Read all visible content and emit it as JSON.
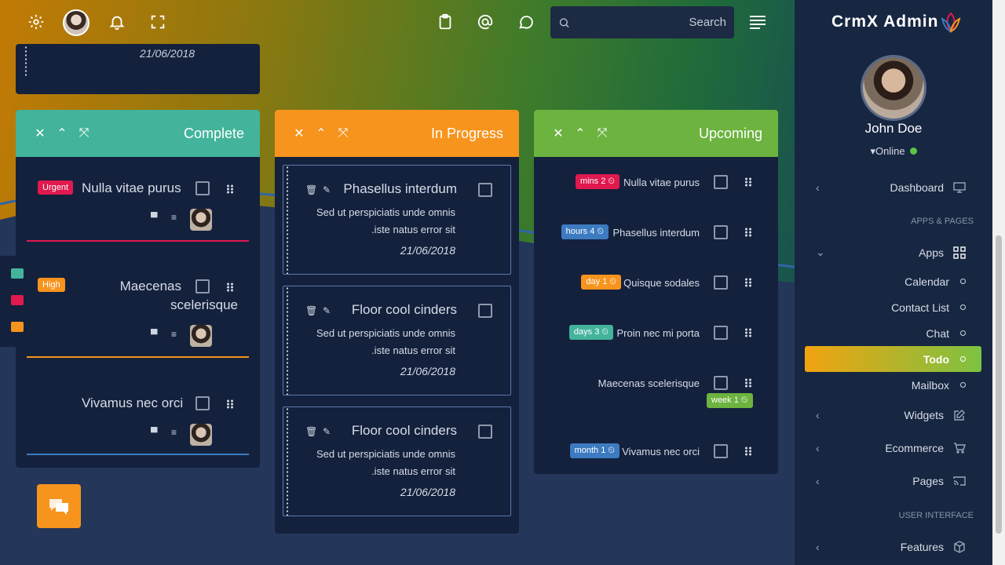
{
  "brand": {
    "name": "CrmX Admin"
  },
  "search": {
    "placeholder": "Search"
  },
  "top_card": {
    "date": "21/06/2018"
  },
  "columns": {
    "complete": {
      "title": "Complete",
      "items": [
        {
          "badge": "Urgent",
          "name": "Nulla vitae purus"
        },
        {
          "badge": "High",
          "name_line1": "Maecenas",
          "name_line2": "scelerisque"
        },
        {
          "name": "Vivamus nec orci"
        }
      ]
    },
    "progress": {
      "title": "In Progress",
      "items": [
        {
          "name": "Phasellus interdum",
          "desc1": "Sed ut perspiciatis unde omnis",
          "desc2": ".iste natus error sit",
          "date": "21/06/2018"
        },
        {
          "name": "Floor cool cinders",
          "desc1": "Sed ut perspiciatis unde omnis",
          "desc2": ".iste natus error sit",
          "date": "21/06/2018"
        },
        {
          "name": "Floor cool cinders",
          "desc1": "Sed ut perspiciatis unde omnis",
          "desc2": ".iste natus error sit",
          "date": "21/06/2018"
        }
      ]
    },
    "upcoming": {
      "title": "Upcoming",
      "items": [
        {
          "badge": "mins 2",
          "name": "Nulla vitae purus",
          "color": "#e0194f"
        },
        {
          "badge": "hours 4",
          "name": "Phasellus interdum",
          "color": "#3c7bc0"
        },
        {
          "badge": "day 1",
          "name": "Quisque sodales",
          "color": "#f7941d"
        },
        {
          "badge": "days 3",
          "name": "Proin nec mi porta",
          "color": "#43b49b"
        },
        {
          "badge": "week 1",
          "name": "Maecenas scelerisque",
          "color": "#6cb33f"
        },
        {
          "badge": "month 1",
          "name": "Vivamus nec orci",
          "color": "#3c7bc0"
        }
      ]
    }
  },
  "profile": {
    "name": "John Doe",
    "status": "Online"
  },
  "nav": {
    "dashboard": "Dashboard",
    "section_apps": "APPS & PAGES",
    "apps": "Apps",
    "calendar": "Calendar",
    "contact": "Contact List",
    "chat": "Chat",
    "todo": "Todo",
    "mailbox": "Mailbox",
    "widgets": "Widgets",
    "ecommerce": "Ecommerce",
    "pages": "Pages",
    "section_ui": "USER INTERFACE",
    "features": "Features"
  },
  "colors": {
    "complete": "#43b49b",
    "progress": "#f7941d",
    "upcoming": "#6cb33f",
    "urgent": "#e0194f",
    "high": "#f7941d"
  }
}
